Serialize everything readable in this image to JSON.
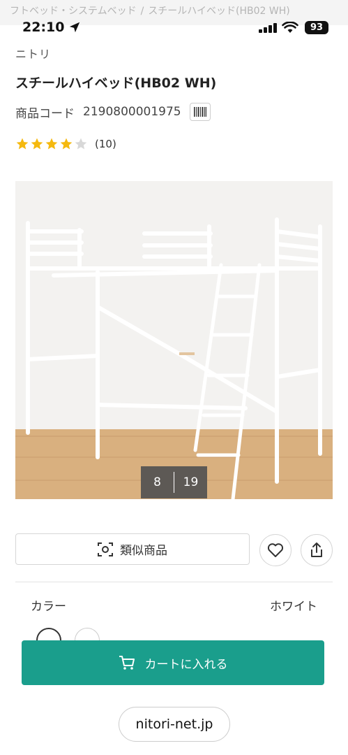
{
  "breadcrumb": {
    "items": [
      "フトベッド・システムベッド",
      "スチールハイベッド(HB02 WH)"
    ],
    "separator": "/"
  },
  "status_bar": {
    "time": "22:10",
    "battery": "93"
  },
  "product": {
    "brand": "ニトリ",
    "title": "スチールハイベッド(HB02 WH)",
    "code_label": "商品コード",
    "code_value": "2190800001975",
    "rating": 4,
    "rating_max": 5,
    "review_count": "(10)"
  },
  "gallery": {
    "current": "8",
    "total": "19"
  },
  "actions": {
    "similar_label": "類似商品",
    "favorite_icon": "heart-icon",
    "share_icon": "share-icon"
  },
  "color": {
    "label": "カラー",
    "value": "ホワイト"
  },
  "cart": {
    "label": "カートに入れる"
  },
  "browser": {
    "url": "nitori-net.jp"
  },
  "colors": {
    "accent": "#1a9e8c",
    "star": "#f5b90f",
    "star_empty": "#d8d8d8"
  }
}
